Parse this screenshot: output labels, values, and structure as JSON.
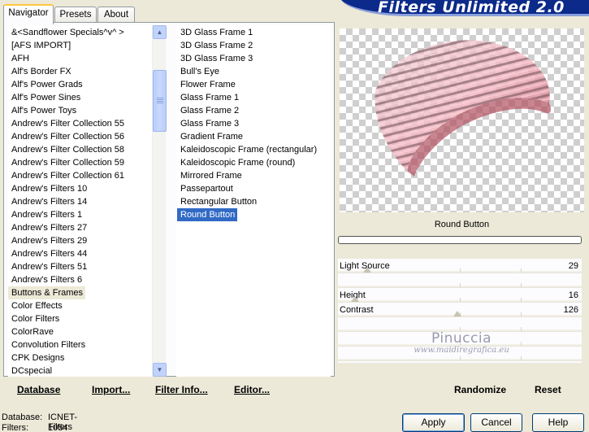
{
  "app": {
    "title": "Filters Unlimited 2.0"
  },
  "tabs": [
    "Navigator",
    "Presets",
    "About"
  ],
  "categories": [
    "&<Sandflower Specials^v^ >",
    "[AFS IMPORT]",
    "AFH",
    "Alf's Border FX",
    "Alf's Power Grads",
    "Alf's Power Sines",
    "Alf's Power Toys",
    "Andrew's Filter Collection 55",
    "Andrew's Filter Collection 56",
    "Andrew's Filter Collection 58",
    "Andrew's Filter Collection 59",
    "Andrew's Filter Collection 61",
    "Andrew's Filters 10",
    "Andrew's Filters 14",
    "Andrew's Filters 1",
    "Andrew's Filters 27",
    "Andrew's Filters 29",
    "Andrew's Filters 44",
    "Andrew's Filters 51",
    "Andrew's Filters 6",
    "Buttons & Frames",
    "Color Effects",
    "Color Filters",
    "ColorRave",
    "Convolution Filters",
    "CPK Designs",
    "DCspecial"
  ],
  "filters": [
    "3D Glass Frame 1",
    "3D Glass Frame 2",
    "3D Glass Frame 3",
    "Bull's Eye",
    "Flower Frame",
    "Glass Frame 1",
    "Glass Frame 2",
    "Glass Frame 3",
    "Gradient Frame",
    "Kaleidoscopic Frame (rectangular)",
    "Kaleidoscopic Frame (round)",
    "Mirrored Frame",
    "Passepartout",
    "Rectangular Button",
    "Round Button"
  ],
  "preview": {
    "filter_name": "Round Button"
  },
  "sliders": [
    {
      "label": "Light Source",
      "value": "29"
    },
    {
      "label": "",
      "value": ""
    },
    {
      "label": "Height",
      "value": "16"
    },
    {
      "label": "Contrast",
      "value": "126"
    },
    {
      "label": "",
      "value": ""
    },
    {
      "label": "",
      "value": ""
    },
    {
      "label": "",
      "value": ""
    }
  ],
  "watermark": {
    "line1": "Pinuccia",
    "line2": "www.maidiregrafica.eu"
  },
  "links": {
    "database": "Database",
    "import": "Import...",
    "filter_info": "Filter Info...",
    "editor": "Editor...",
    "randomize": "Randomize",
    "reset": "Reset"
  },
  "status": {
    "database_label": "Database:",
    "database_value": "ICNET-Filters",
    "filters_label": "Filters:",
    "filters_value": "1054"
  },
  "buttons": {
    "apply": "Apply",
    "cancel": "Cancel",
    "help": "Help"
  },
  "colors": {
    "banner": "#0c2a8a",
    "selection": "#316ac5",
    "frame": "#ece9d8"
  }
}
